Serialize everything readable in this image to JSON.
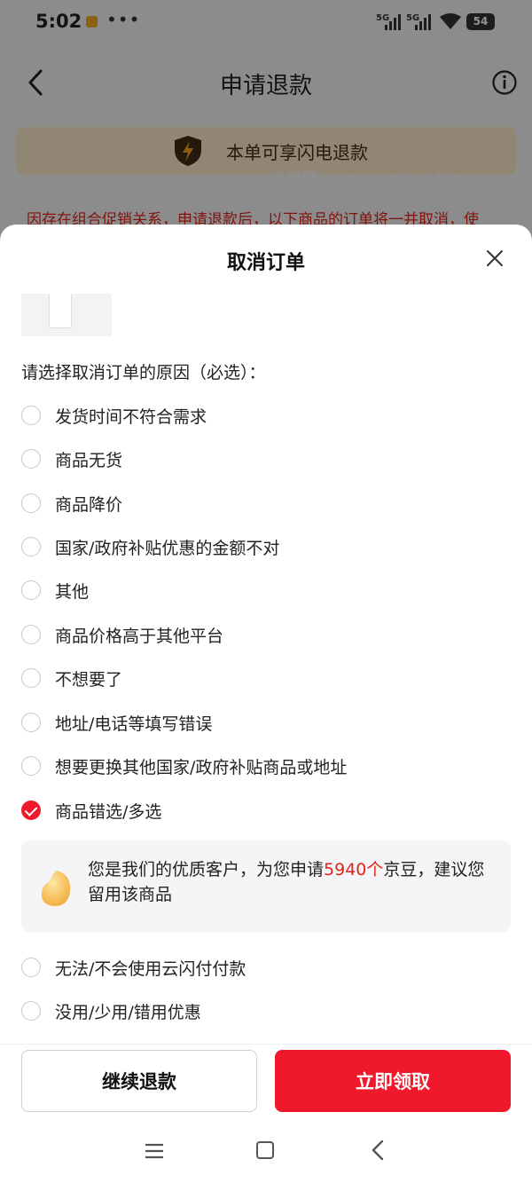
{
  "status_bar": {
    "time": "5:02",
    "network_1": "5G",
    "network_2": "5G",
    "battery": "54"
  },
  "nav": {
    "title": "申请退款"
  },
  "banner": {
    "text": "本单可享闪电退款"
  },
  "watermark": "线报酷-new.xianbao.fun",
  "notice": "因存在组合促销关系，申请退款后，以下商品的订单将一并取消，使",
  "sheet": {
    "title": "取消订单",
    "prompt": "请选择取消订单的原因（必选）：",
    "reasons": [
      {
        "label": "发货时间不符合需求",
        "checked": false
      },
      {
        "label": "商品无货",
        "checked": false
      },
      {
        "label": "商品降价",
        "checked": false
      },
      {
        "label": "国家/政府补贴优惠的金额不对",
        "checked": false
      },
      {
        "label": "其他",
        "checked": false
      },
      {
        "label": "商品价格高于其他平台",
        "checked": false
      },
      {
        "label": "不想要了",
        "checked": false
      },
      {
        "label": "地址/电话等填写错误",
        "checked": false
      },
      {
        "label": "想要更换其他国家/政府补贴商品或地址",
        "checked": false
      },
      {
        "label": "商品错选/多选",
        "checked": true
      },
      {
        "label": "无法/不会使用云闪付付款",
        "checked": false
      },
      {
        "label": "没用/少用/错用优惠",
        "checked": false
      }
    ],
    "bean_card": {
      "text_before": "您是我们的优质客户，为您申请",
      "amount": "5940个",
      "text_after": "京豆，建议您留用该商品"
    },
    "buttons": {
      "continue": "继续退款",
      "claim": "立即领取"
    }
  },
  "colors": {
    "accent": "#f0192b",
    "highlight_text": "#e0241b",
    "banner_bg": "#f8e7c6"
  },
  "icons": [
    "back-icon",
    "info-icon",
    "flash-shield-icon",
    "close-icon",
    "bean-icon",
    "menu-icon",
    "home-icon",
    "nav-back-icon"
  ]
}
